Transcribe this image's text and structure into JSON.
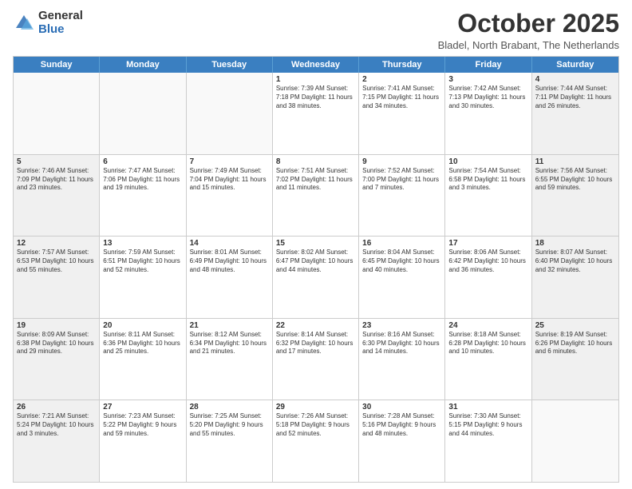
{
  "logo": {
    "general": "General",
    "blue": "Blue"
  },
  "title": "October 2025",
  "location": "Bladel, North Brabant, The Netherlands",
  "header_days": [
    "Sunday",
    "Monday",
    "Tuesday",
    "Wednesday",
    "Thursday",
    "Friday",
    "Saturday"
  ],
  "weeks": [
    [
      {
        "day": "",
        "text": "",
        "empty": true
      },
      {
        "day": "",
        "text": "",
        "empty": true
      },
      {
        "day": "",
        "text": "",
        "empty": true
      },
      {
        "day": "1",
        "text": "Sunrise: 7:39 AM\nSunset: 7:18 PM\nDaylight: 11 hours\nand 38 minutes.",
        "empty": false
      },
      {
        "day": "2",
        "text": "Sunrise: 7:41 AM\nSunset: 7:15 PM\nDaylight: 11 hours\nand 34 minutes.",
        "empty": false
      },
      {
        "day": "3",
        "text": "Sunrise: 7:42 AM\nSunset: 7:13 PM\nDaylight: 11 hours\nand 30 minutes.",
        "empty": false
      },
      {
        "day": "4",
        "text": "Sunrise: 7:44 AM\nSunset: 7:11 PM\nDaylight: 11 hours\nand 26 minutes.",
        "empty": false,
        "shaded": true
      }
    ],
    [
      {
        "day": "5",
        "text": "Sunrise: 7:46 AM\nSunset: 7:09 PM\nDaylight: 11 hours\nand 23 minutes.",
        "empty": false,
        "shaded": true
      },
      {
        "day": "6",
        "text": "Sunrise: 7:47 AM\nSunset: 7:06 PM\nDaylight: 11 hours\nand 19 minutes.",
        "empty": false
      },
      {
        "day": "7",
        "text": "Sunrise: 7:49 AM\nSunset: 7:04 PM\nDaylight: 11 hours\nand 15 minutes.",
        "empty": false
      },
      {
        "day": "8",
        "text": "Sunrise: 7:51 AM\nSunset: 7:02 PM\nDaylight: 11 hours\nand 11 minutes.",
        "empty": false
      },
      {
        "day": "9",
        "text": "Sunrise: 7:52 AM\nSunset: 7:00 PM\nDaylight: 11 hours\nand 7 minutes.",
        "empty": false
      },
      {
        "day": "10",
        "text": "Sunrise: 7:54 AM\nSunset: 6:58 PM\nDaylight: 11 hours\nand 3 minutes.",
        "empty": false
      },
      {
        "day": "11",
        "text": "Sunrise: 7:56 AM\nSunset: 6:55 PM\nDaylight: 10 hours\nand 59 minutes.",
        "empty": false,
        "shaded": true
      }
    ],
    [
      {
        "day": "12",
        "text": "Sunrise: 7:57 AM\nSunset: 6:53 PM\nDaylight: 10 hours\nand 55 minutes.",
        "empty": false,
        "shaded": true
      },
      {
        "day": "13",
        "text": "Sunrise: 7:59 AM\nSunset: 6:51 PM\nDaylight: 10 hours\nand 52 minutes.",
        "empty": false
      },
      {
        "day": "14",
        "text": "Sunrise: 8:01 AM\nSunset: 6:49 PM\nDaylight: 10 hours\nand 48 minutes.",
        "empty": false
      },
      {
        "day": "15",
        "text": "Sunrise: 8:02 AM\nSunset: 6:47 PM\nDaylight: 10 hours\nand 44 minutes.",
        "empty": false
      },
      {
        "day": "16",
        "text": "Sunrise: 8:04 AM\nSunset: 6:45 PM\nDaylight: 10 hours\nand 40 minutes.",
        "empty": false
      },
      {
        "day": "17",
        "text": "Sunrise: 8:06 AM\nSunset: 6:42 PM\nDaylight: 10 hours\nand 36 minutes.",
        "empty": false
      },
      {
        "day": "18",
        "text": "Sunrise: 8:07 AM\nSunset: 6:40 PM\nDaylight: 10 hours\nand 32 minutes.",
        "empty": false,
        "shaded": true
      }
    ],
    [
      {
        "day": "19",
        "text": "Sunrise: 8:09 AM\nSunset: 6:38 PM\nDaylight: 10 hours\nand 29 minutes.",
        "empty": false,
        "shaded": true
      },
      {
        "day": "20",
        "text": "Sunrise: 8:11 AM\nSunset: 6:36 PM\nDaylight: 10 hours\nand 25 minutes.",
        "empty": false
      },
      {
        "day": "21",
        "text": "Sunrise: 8:12 AM\nSunset: 6:34 PM\nDaylight: 10 hours\nand 21 minutes.",
        "empty": false
      },
      {
        "day": "22",
        "text": "Sunrise: 8:14 AM\nSunset: 6:32 PM\nDaylight: 10 hours\nand 17 minutes.",
        "empty": false
      },
      {
        "day": "23",
        "text": "Sunrise: 8:16 AM\nSunset: 6:30 PM\nDaylight: 10 hours\nand 14 minutes.",
        "empty": false
      },
      {
        "day": "24",
        "text": "Sunrise: 8:18 AM\nSunset: 6:28 PM\nDaylight: 10 hours\nand 10 minutes.",
        "empty": false
      },
      {
        "day": "25",
        "text": "Sunrise: 8:19 AM\nSunset: 6:26 PM\nDaylight: 10 hours\nand 6 minutes.",
        "empty": false,
        "shaded": true
      }
    ],
    [
      {
        "day": "26",
        "text": "Sunrise: 7:21 AM\nSunset: 5:24 PM\nDaylight: 10 hours\nand 3 minutes.",
        "empty": false,
        "shaded": true
      },
      {
        "day": "27",
        "text": "Sunrise: 7:23 AM\nSunset: 5:22 PM\nDaylight: 9 hours\nand 59 minutes.",
        "empty": false
      },
      {
        "day": "28",
        "text": "Sunrise: 7:25 AM\nSunset: 5:20 PM\nDaylight: 9 hours\nand 55 minutes.",
        "empty": false
      },
      {
        "day": "29",
        "text": "Sunrise: 7:26 AM\nSunset: 5:18 PM\nDaylight: 9 hours\nand 52 minutes.",
        "empty": false
      },
      {
        "day": "30",
        "text": "Sunrise: 7:28 AM\nSunset: 5:16 PM\nDaylight: 9 hours\nand 48 minutes.",
        "empty": false
      },
      {
        "day": "31",
        "text": "Sunrise: 7:30 AM\nSunset: 5:15 PM\nDaylight: 9 hours\nand 44 minutes.",
        "empty": false
      },
      {
        "day": "",
        "text": "",
        "empty": true,
        "shaded": true
      }
    ]
  ]
}
